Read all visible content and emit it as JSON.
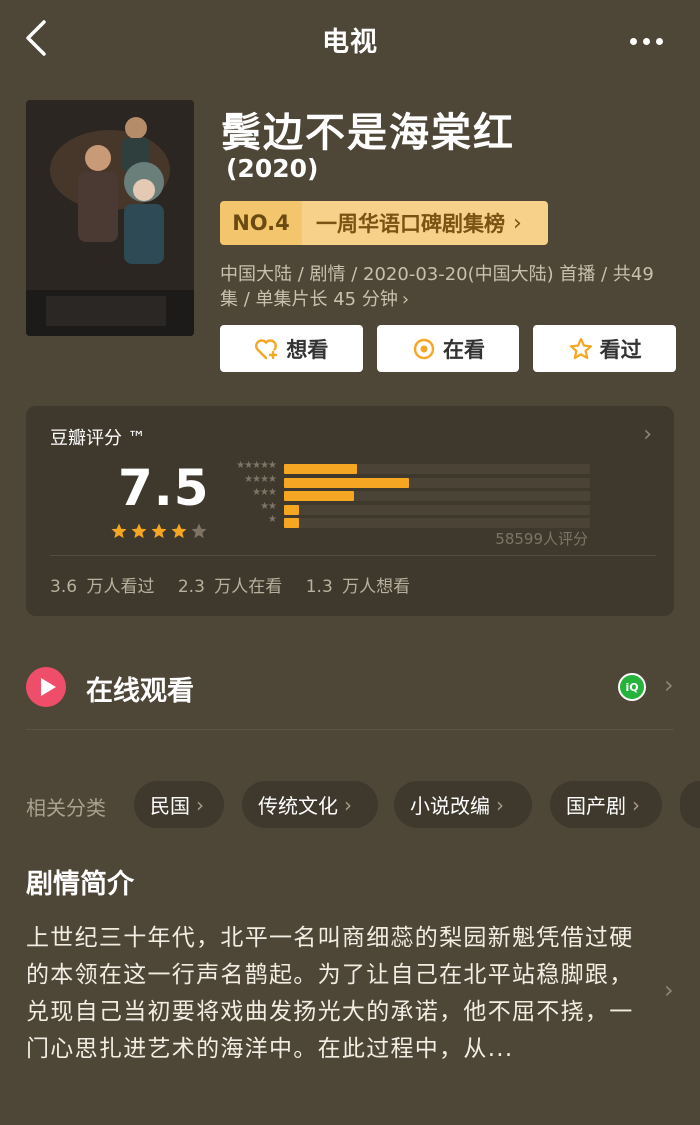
{
  "nav": {
    "title": "电视"
  },
  "header": {
    "title": "鬓边不是海棠红",
    "year": "(2020)",
    "rank_no": "NO.4",
    "rank_list": "一周华语口碑剧集榜",
    "meta": "中国大陆 / 剧情 / 2020-03-20(中国大陆) 首播 / 共49集 / 单集片长 45 分钟",
    "poster_text": "鬓边不是海棠红",
    "buttons": {
      "want": "想看",
      "watching": "在看",
      "watched": "看过"
    }
  },
  "rating": {
    "label": "豆瓣评分 ™",
    "score": "7.5",
    "stars": 4,
    "count": "58599人评分",
    "distribution": [
      {
        "label": "★★★★★",
        "value": 0.24
      },
      {
        "label": "★★★★",
        "value": 0.41
      },
      {
        "label": "★★★",
        "value": 0.23
      },
      {
        "label": "★★",
        "value": 0.05
      },
      {
        "label": "★",
        "value": 0.05
      }
    ],
    "stats": {
      "watched": "3.6 万人看过",
      "watching": "2.3 万人在看",
      "want": "1.3 万人想看"
    }
  },
  "online": {
    "label": "在线观看",
    "provider": "iQIYI"
  },
  "tags": {
    "label": "相关分类",
    "items": [
      "民国",
      "传统文化",
      "小说改编",
      "国产剧"
    ]
  },
  "synopsis": {
    "title": "剧情简介",
    "text": "上世纪三十年代，北平一名叫商细蕊的梨园新魁凭借过硬的本领在这一行声名鹊起。为了让自己在北平站稳脚跟，兑现自己当初要将戏曲发扬光大的承诺，他不屈不挠，一门心思扎进艺术的海洋中。在此过程中，从..."
  },
  "colors": {
    "accent": "#f5a623",
    "bg": "#4e4636",
    "card": "#3f382c",
    "play": "#ef4e6b",
    "iqiyi": "#25b33c"
  }
}
